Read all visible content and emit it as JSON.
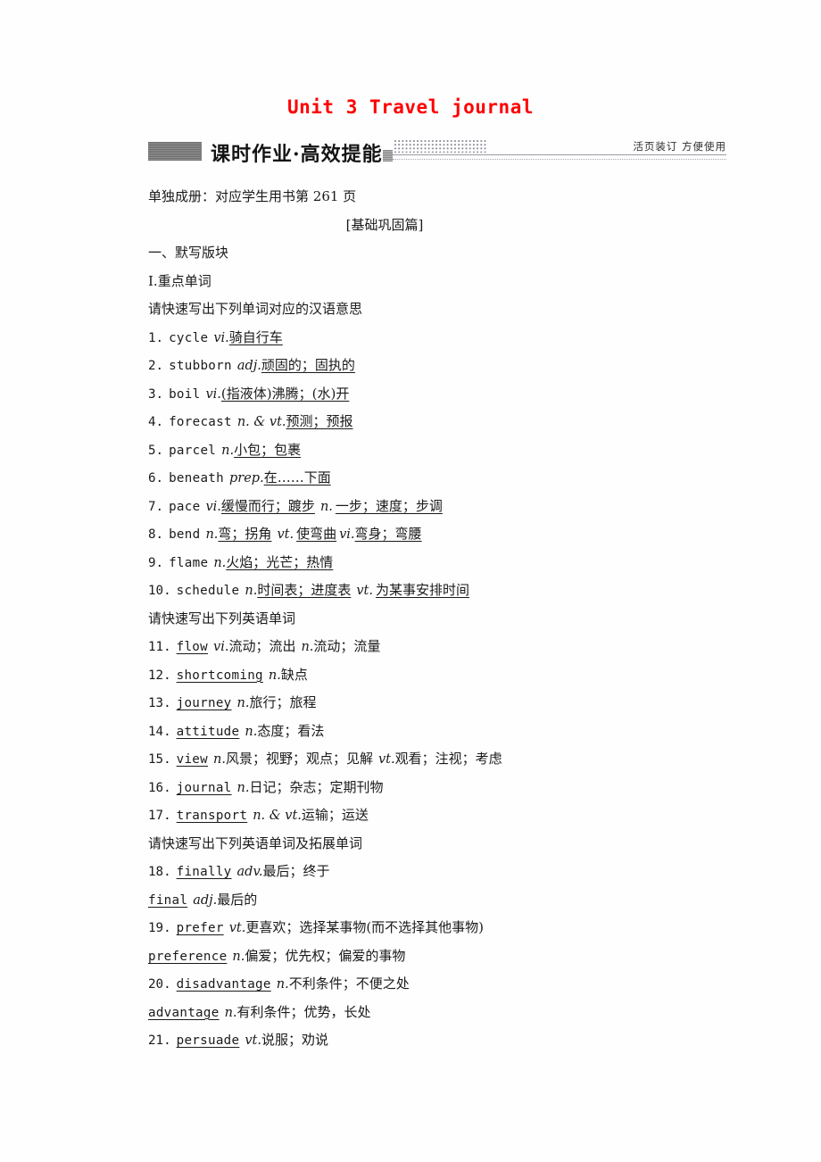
{
  "document": {
    "unit_title": "Unit 3 Travel journal",
    "banner": {
      "title": "课时作业·高效提能",
      "right_note": "活页装订  方便使用"
    },
    "subtitle": "单独成册：对应学生用书第 261 页",
    "section_tag": "[基础巩固篇]",
    "part_heading": "一、默写版块",
    "block_heading": "Ⅰ.重点单词",
    "instruction_cn_meaning": "请快速写出下列单词对应的汉语意思",
    "instruction_en_word": "请快速写出下列英语单词",
    "instruction_en_word_ext": "请快速写出下列英语单词及拓展单词"
  },
  "words_cn_meaning": [
    {
      "num": "1.",
      "word": "cycle",
      "pos1": "vi.",
      "ans1": "骑自行车",
      "pos2": "",
      "ans2": ""
    },
    {
      "num": "2.",
      "word": "stubborn",
      "pos1": "adj.",
      "ans1": "顽固的；固执的",
      "pos2": "",
      "ans2": ""
    },
    {
      "num": "3.",
      "word": "boil",
      "pos1": "vi.",
      "ans1": "(指液体)沸腾；(水)开",
      "pos2": "",
      "ans2": ""
    },
    {
      "num": "4.",
      "word": "forecast",
      "pos1": "n. & vt.",
      "ans1": "预测；预报",
      "pos2": "",
      "ans2": ""
    },
    {
      "num": "5.",
      "word": "parcel",
      "pos1": "n.",
      "ans1": "小包；包裹",
      "pos2": "",
      "ans2": ""
    },
    {
      "num": "6.",
      "word": "beneath",
      "pos1": "prep.",
      "ans1": "在……下面",
      "pos2": "",
      "ans2": ""
    },
    {
      "num": "7.",
      "word": "pace",
      "pos1": "vi.",
      "ans1": "缓慢而行；踱步",
      "pos2": "n.",
      "ans2": "一步；速度；步调"
    },
    {
      "num": "8.",
      "word": "bend",
      "pos1": "n.",
      "ans1": "弯；拐角",
      "pos2": "vt.",
      "ans2": "使弯曲",
      "pos3": "vi.",
      "ans3": "弯身；弯腰"
    },
    {
      "num": "9.",
      "word": "flame",
      "pos1": "n.",
      "ans1": "火焰；光芒；热情",
      "pos2": "",
      "ans2": ""
    },
    {
      "num": "10.",
      "word": "schedule",
      "pos1": "n.",
      "ans1": "时间表；进度表",
      "pos2": "vt.",
      "ans2": "为某事安排时间"
    }
  ],
  "words_en_word": [
    {
      "num": "11.",
      "word": "flow",
      "pos1": "vi.",
      "mean1": "流动；流出",
      "pos2": "n.",
      "mean2": "流动；流量"
    },
    {
      "num": "12.",
      "word": "shortcoming",
      "pos1": "n.",
      "mean1": "缺点",
      "pos2": "",
      "mean2": ""
    },
    {
      "num": "13.",
      "word": "journey",
      "pos1": "n.",
      "mean1": "旅行；旅程",
      "pos2": "",
      "mean2": ""
    },
    {
      "num": "14.",
      "word": "attitude",
      "pos1": "n.",
      "mean1": "态度；看法",
      "pos2": "",
      "mean2": ""
    },
    {
      "num": "15.",
      "word": "view",
      "pos1": "n.",
      "mean1": "风景；视野；观点；见解",
      "pos2": "vt.",
      "mean2": "观看；注视；考虑"
    },
    {
      "num": "16.",
      "word": "journal",
      "pos1": "n.",
      "mean1": "日记；杂志；定期刊物",
      "pos2": "",
      "mean2": ""
    },
    {
      "num": "17.",
      "word": "transport",
      "pos1": "n. & vt.",
      "mean1": "运输；运送",
      "pos2": "",
      "mean2": ""
    }
  ],
  "words_en_extended": [
    {
      "num": "18.",
      "word": "finally",
      "pos1": "adv.",
      "mean1": "最后；终于"
    },
    {
      "num": "",
      "word": "final",
      "pos1": "adj.",
      "mean1": "最后的"
    },
    {
      "num": "19.",
      "word": "prefer",
      "pos1": "vt.",
      "mean1": "更喜欢；选择某事物(而不选择其他事物)"
    },
    {
      "num": "",
      "word": "preference",
      "pos1": "n.",
      "mean1": "偏爱；优先权；偏爱的事物"
    },
    {
      "num": "20.",
      "word": "disadvantage",
      "pos1": "n.",
      "mean1": "不利条件；不便之处"
    },
    {
      "num": "",
      "word": "advantage",
      "pos1": "n.",
      "mean1": "有利条件；优势，长处"
    },
    {
      "num": "21.",
      "word": "persuade",
      "pos1": "vt.",
      "mean1": "说服；劝说"
    }
  ],
  "colors": {
    "title_red": "#ff0000",
    "text": "#1a1a1a",
    "rule_gray": "#9b9ba8"
  }
}
